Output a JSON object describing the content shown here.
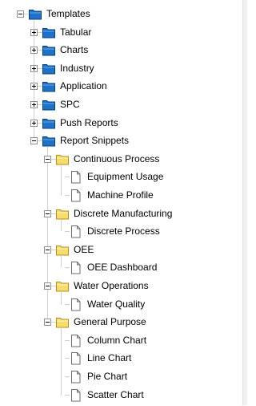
{
  "colors": {
    "category_folder_fill": "#1e72c8",
    "category_folder_stroke": "#0b3f7a",
    "category_folder_tab": "#3f8fe0",
    "group_folder_fill": "#f6dd6b",
    "group_folder_stroke": "#b8901c",
    "group_folder_tab": "#fbe99a",
    "document_fill": "#ffffff",
    "document_stroke": "#6b6b6b",
    "connector_line": "#a0a0a0",
    "expander_border": "#919191"
  },
  "tree": {
    "root": {
      "label": "Templates",
      "expanded": true,
      "icon": "folder-icon"
    },
    "categories": [
      {
        "label": "Tabular",
        "expanded": false,
        "icon": "folder-icon"
      },
      {
        "label": "Charts",
        "expanded": false,
        "icon": "folder-icon"
      },
      {
        "label": "Industry",
        "expanded": false,
        "icon": "folder-icon"
      },
      {
        "label": "Application",
        "expanded": false,
        "icon": "folder-icon"
      },
      {
        "label": "SPC",
        "expanded": false,
        "icon": "folder-icon"
      },
      {
        "label": "Push Reports",
        "expanded": false,
        "icon": "folder-icon"
      },
      {
        "label": "Report Snippets",
        "expanded": true,
        "icon": "folder-icon"
      }
    ],
    "snippet_groups": [
      {
        "label": "Continuous Process",
        "expanded": true,
        "icon": "folder-icon",
        "items": [
          {
            "label": "Equipment Usage",
            "icon": "document-icon"
          },
          {
            "label": "Machine Profile",
            "icon": "document-icon"
          }
        ]
      },
      {
        "label": "Discrete Manufacturing",
        "expanded": true,
        "icon": "folder-icon",
        "items": [
          {
            "label": "Discrete Process",
            "icon": "document-icon"
          }
        ]
      },
      {
        "label": "OEE",
        "expanded": true,
        "icon": "folder-icon",
        "items": [
          {
            "label": "OEE Dashboard",
            "icon": "document-icon"
          }
        ]
      },
      {
        "label": "Water Operations",
        "expanded": true,
        "icon": "folder-icon",
        "items": [
          {
            "label": "Water Quality",
            "icon": "document-icon"
          }
        ]
      },
      {
        "label": "General Purpose",
        "expanded": true,
        "icon": "folder-icon",
        "items": [
          {
            "label": "Column Chart",
            "icon": "document-icon"
          },
          {
            "label": "Line Chart",
            "icon": "document-icon"
          },
          {
            "label": "Pie Chart",
            "icon": "document-icon"
          },
          {
            "label": "Scatter Chart",
            "icon": "document-icon"
          }
        ]
      }
    ]
  }
}
